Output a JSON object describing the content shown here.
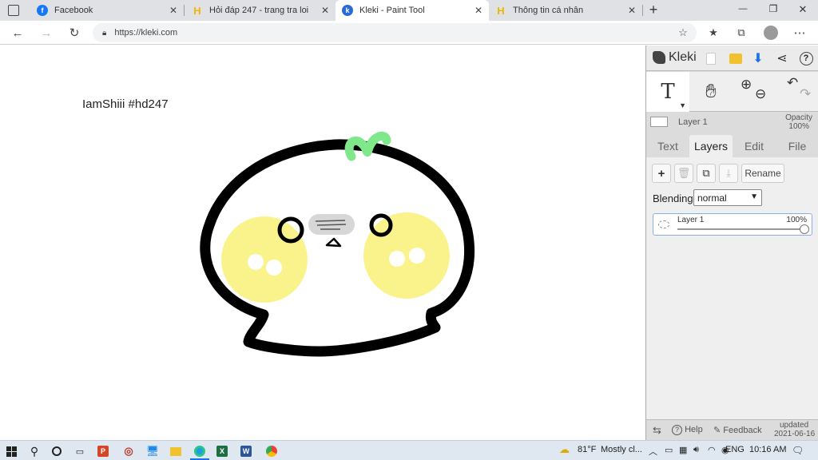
{
  "browser": {
    "tabs": [
      {
        "label": "Facebook",
        "icon": "facebook-icon",
        "active": false
      },
      {
        "label": "Hỏi đáp 247 - trang tra loi",
        "icon": "hoidap-icon",
        "active": false
      },
      {
        "label": "Kleki - Paint Tool",
        "icon": "kleki-favicon",
        "active": true
      },
      {
        "label": "Thông tin cá nhân",
        "icon": "hoidap-icon",
        "active": false
      }
    ],
    "close_glyph": "✕",
    "new_tab_glyph": "+",
    "window_controls": [
      "—",
      "❐",
      "✕"
    ],
    "url": "https://kleki.com"
  },
  "canvas": {
    "text": "IamShiii #hd247"
  },
  "kleki": {
    "logo_text": "Kleki",
    "layer_name": "Layer 1",
    "opacity_label": "Opacity",
    "opacity_value": "100%",
    "tabs": [
      "Text",
      "Layers",
      "Edit",
      "File"
    ],
    "active_tab": "Layers",
    "rename_label": "Rename",
    "blending_label": "Blending",
    "blending_value": "normal",
    "layer_row": {
      "name": "Layer 1",
      "opacity": "100%"
    },
    "footer": {
      "help": "Help",
      "feedback": "Feedback",
      "updated_label": "updated",
      "updated_date": "2021-06-16"
    }
  },
  "taskbar": {
    "weather_temp": "81°F",
    "weather_text": "Mostly cl...",
    "language": "ENG",
    "time": "10:16 AM"
  },
  "colors": {
    "cheek_yellow": "#faf38c",
    "sprout_green": "#7ee88a",
    "accent_blue": "#1a73e8"
  }
}
